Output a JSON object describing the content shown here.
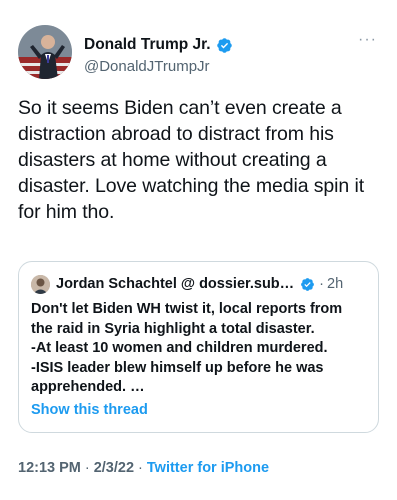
{
  "author": {
    "display_name": "Donald Trump Jr.",
    "handle": "@DonaldJTrumpJr",
    "verified": true
  },
  "tweet": {
    "text": "So it seems Biden can’t even create a distraction abroad to distract from his disasters at home without creating a disaster. Love watching the media spin it for him tho."
  },
  "quoted_tweet": {
    "display_name": "Jordan Schachtel @ dossier.sub…",
    "verified": true,
    "separator": "·",
    "time": "2h",
    "lines": [
      "Don't let Biden WH twist it, local reports from the raid in Syria highlight a total disaster.",
      "-At least 10 women and children murdered.",
      "-ISIS leader blew himself up before he was apprehended. …"
    ],
    "show_thread_label": "Show this thread"
  },
  "meta": {
    "time": "12:13 PM",
    "date": "2/3/22",
    "separator": "·",
    "source": "Twitter for iPhone"
  },
  "icons": {
    "more": "more-icon",
    "verified": "verified-badge-icon"
  },
  "colors": {
    "link_blue": "#1d9bf0",
    "secondary_text": "#536471",
    "border": "#cfd9de"
  }
}
